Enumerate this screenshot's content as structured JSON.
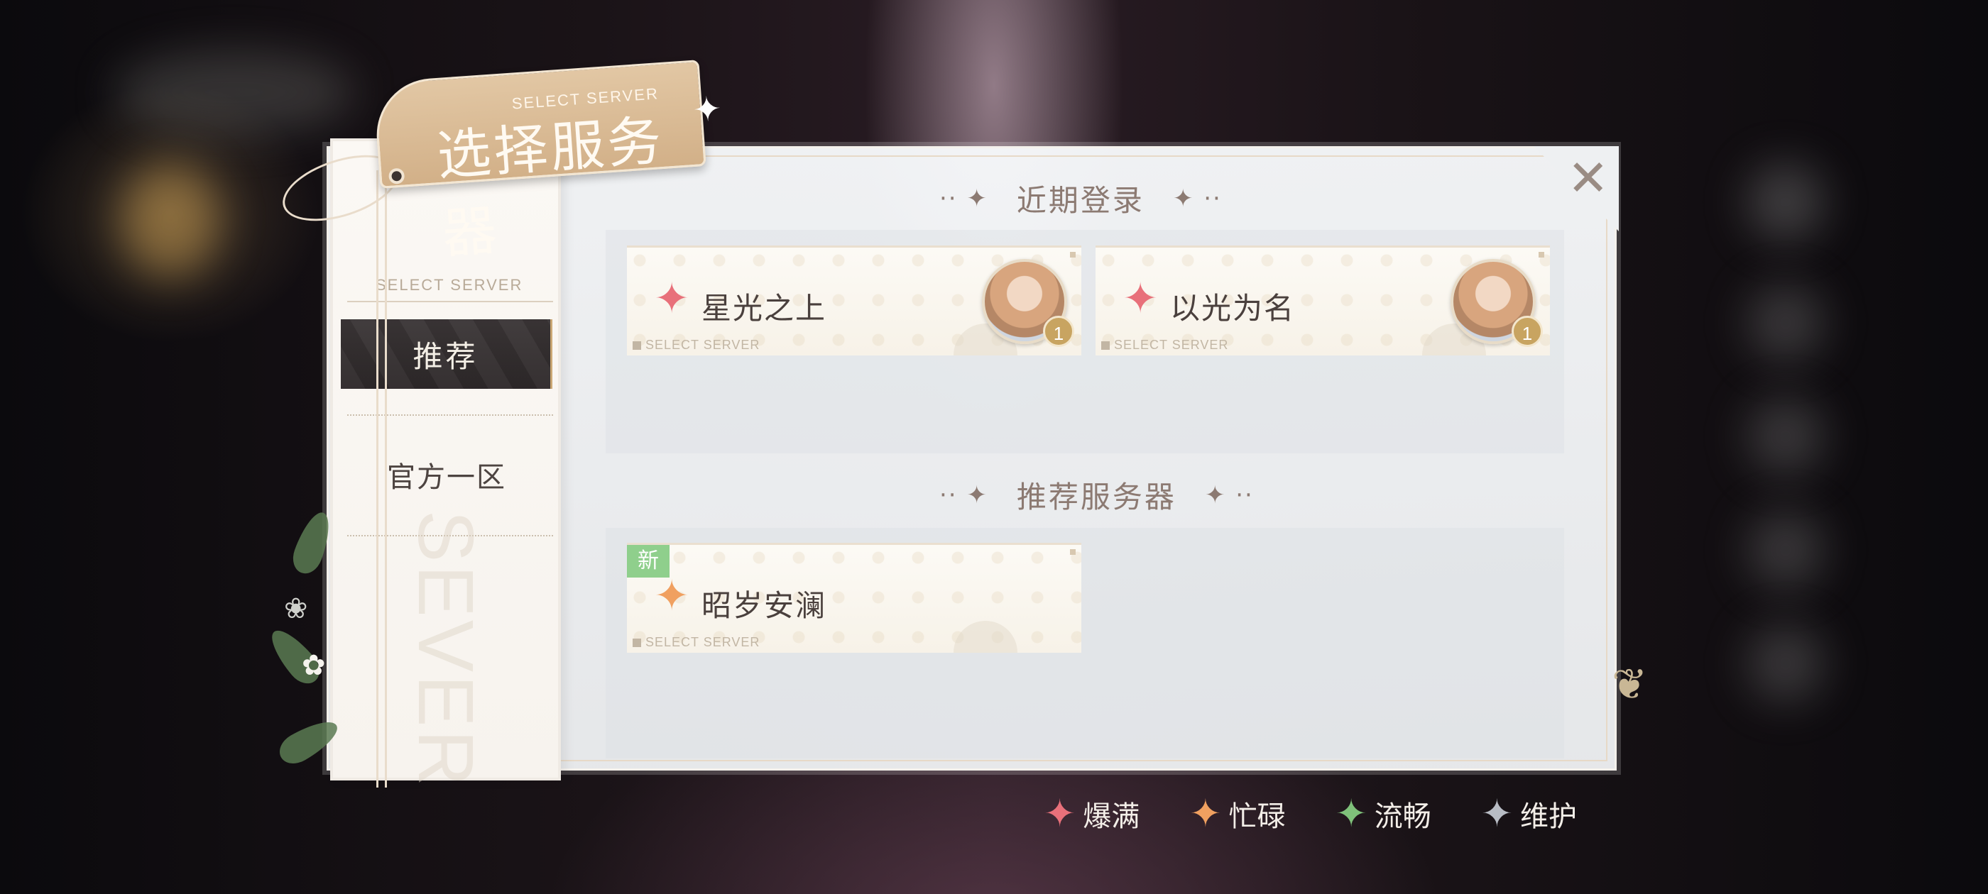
{
  "header": {
    "title": "选择服务器",
    "subtitle": "SELECT SERVER"
  },
  "sidebar": {
    "caption": "SELECT SERVER",
    "watermark": "SEVER",
    "items": [
      {
        "label": "推荐",
        "selected": true
      },
      {
        "label": "官方一区",
        "selected": false
      }
    ]
  },
  "sections": {
    "recent": {
      "title": "近期登录",
      "servers": [
        {
          "name": "星光之上",
          "status": "爆满",
          "status_color": "#e8707a",
          "level": "1",
          "tag": "SELECT SERVER"
        },
        {
          "name": "以光为名",
          "status": "爆满",
          "status_color": "#e8707a",
          "level": "1",
          "tag": "SELECT SERVER"
        }
      ]
    },
    "recommended": {
      "title": "推荐服务器",
      "servers": [
        {
          "name": "昭岁安澜",
          "status": "忙碌",
          "status_color": "#f0a060",
          "badge": "新",
          "tag": "SELECT SERVER"
        }
      ]
    }
  },
  "legend": [
    {
      "label": "爆满",
      "color": "#e8707a"
    },
    {
      "label": "忙碌",
      "color": "#f0a060"
    },
    {
      "label": "流畅",
      "color": "#7fc17a"
    },
    {
      "label": "维护",
      "color": "#b8bcc4"
    }
  ],
  "icons": {
    "close": "close-icon",
    "status_star": "four-point-star-icon"
  }
}
